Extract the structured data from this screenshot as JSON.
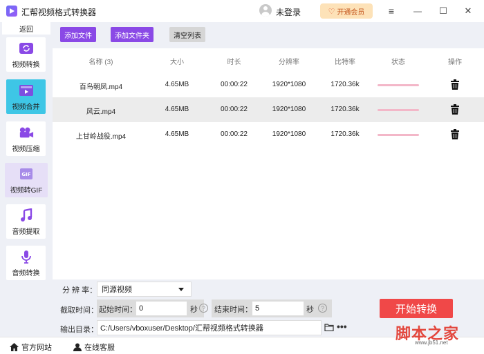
{
  "app": {
    "title": "汇帮视频格式转换器"
  },
  "header": {
    "login_text": "未登录",
    "vip_label": "开通会员",
    "menu_glyph": "≡",
    "minimize_glyph": "—",
    "maximize_glyph": "☐",
    "close_glyph": "✕"
  },
  "sidebar": {
    "back_label": "返回",
    "items": [
      {
        "label": "视频转换",
        "icon": "video-convert-icon"
      },
      {
        "label": "视频合并",
        "icon": "video-merge-icon"
      },
      {
        "label": "视频压缩",
        "icon": "video-compress-icon"
      },
      {
        "label": "视频转GIF",
        "icon": "gif-icon"
      },
      {
        "label": "音频提取",
        "icon": "music-note-icon"
      },
      {
        "label": "音频转换",
        "icon": "microphone-icon"
      }
    ]
  },
  "toolbar": {
    "add_file": "添加文件",
    "add_folder": "添加文件夹",
    "clear_list": "清空列表"
  },
  "table": {
    "headers": [
      "名称 (3)",
      "大小",
      "时长",
      "分辨率",
      "比特率",
      "状态",
      "操作"
    ],
    "rows": [
      {
        "name": "百鸟朝凤.mp4",
        "size": "4.65MB",
        "duration": "00:00:22",
        "resolution": "1920*1080",
        "bitrate": "1720.36k"
      },
      {
        "name": "风云.mp4",
        "size": "4.65MB",
        "duration": "00:00:22",
        "resolution": "1920*1080",
        "bitrate": "1720.36k"
      },
      {
        "name": "上甘岭战役.mp4",
        "size": "4.65MB",
        "duration": "00:00:22",
        "resolution": "1920*1080",
        "bitrate": "1720.36k"
      }
    ]
  },
  "settings": {
    "resolution_label": "分 辨 率：",
    "resolution_value": "同源视频",
    "trim_label": "截取时间：",
    "start_label": "起始时间：",
    "start_value": "0",
    "end_label": "结束时间：",
    "end_value": "5",
    "seconds_unit": "秒",
    "qmark": "?",
    "output_label": "输出目录：",
    "output_path": "C:/Users/vboxuser/Desktop/汇帮视频格式转换器",
    "more_label": "•••",
    "start_button": "开始转换"
  },
  "footer": {
    "website": "官方网站",
    "support": "在线客服"
  },
  "watermark": {
    "main": "脚本之家",
    "sub": "www.jb51.net"
  },
  "colors": {
    "accent_purple": "#8a49e6",
    "active_cyan": "#3ec6e6",
    "start_red": "#f04848",
    "sidebar_bg": "#eef0f6"
  }
}
